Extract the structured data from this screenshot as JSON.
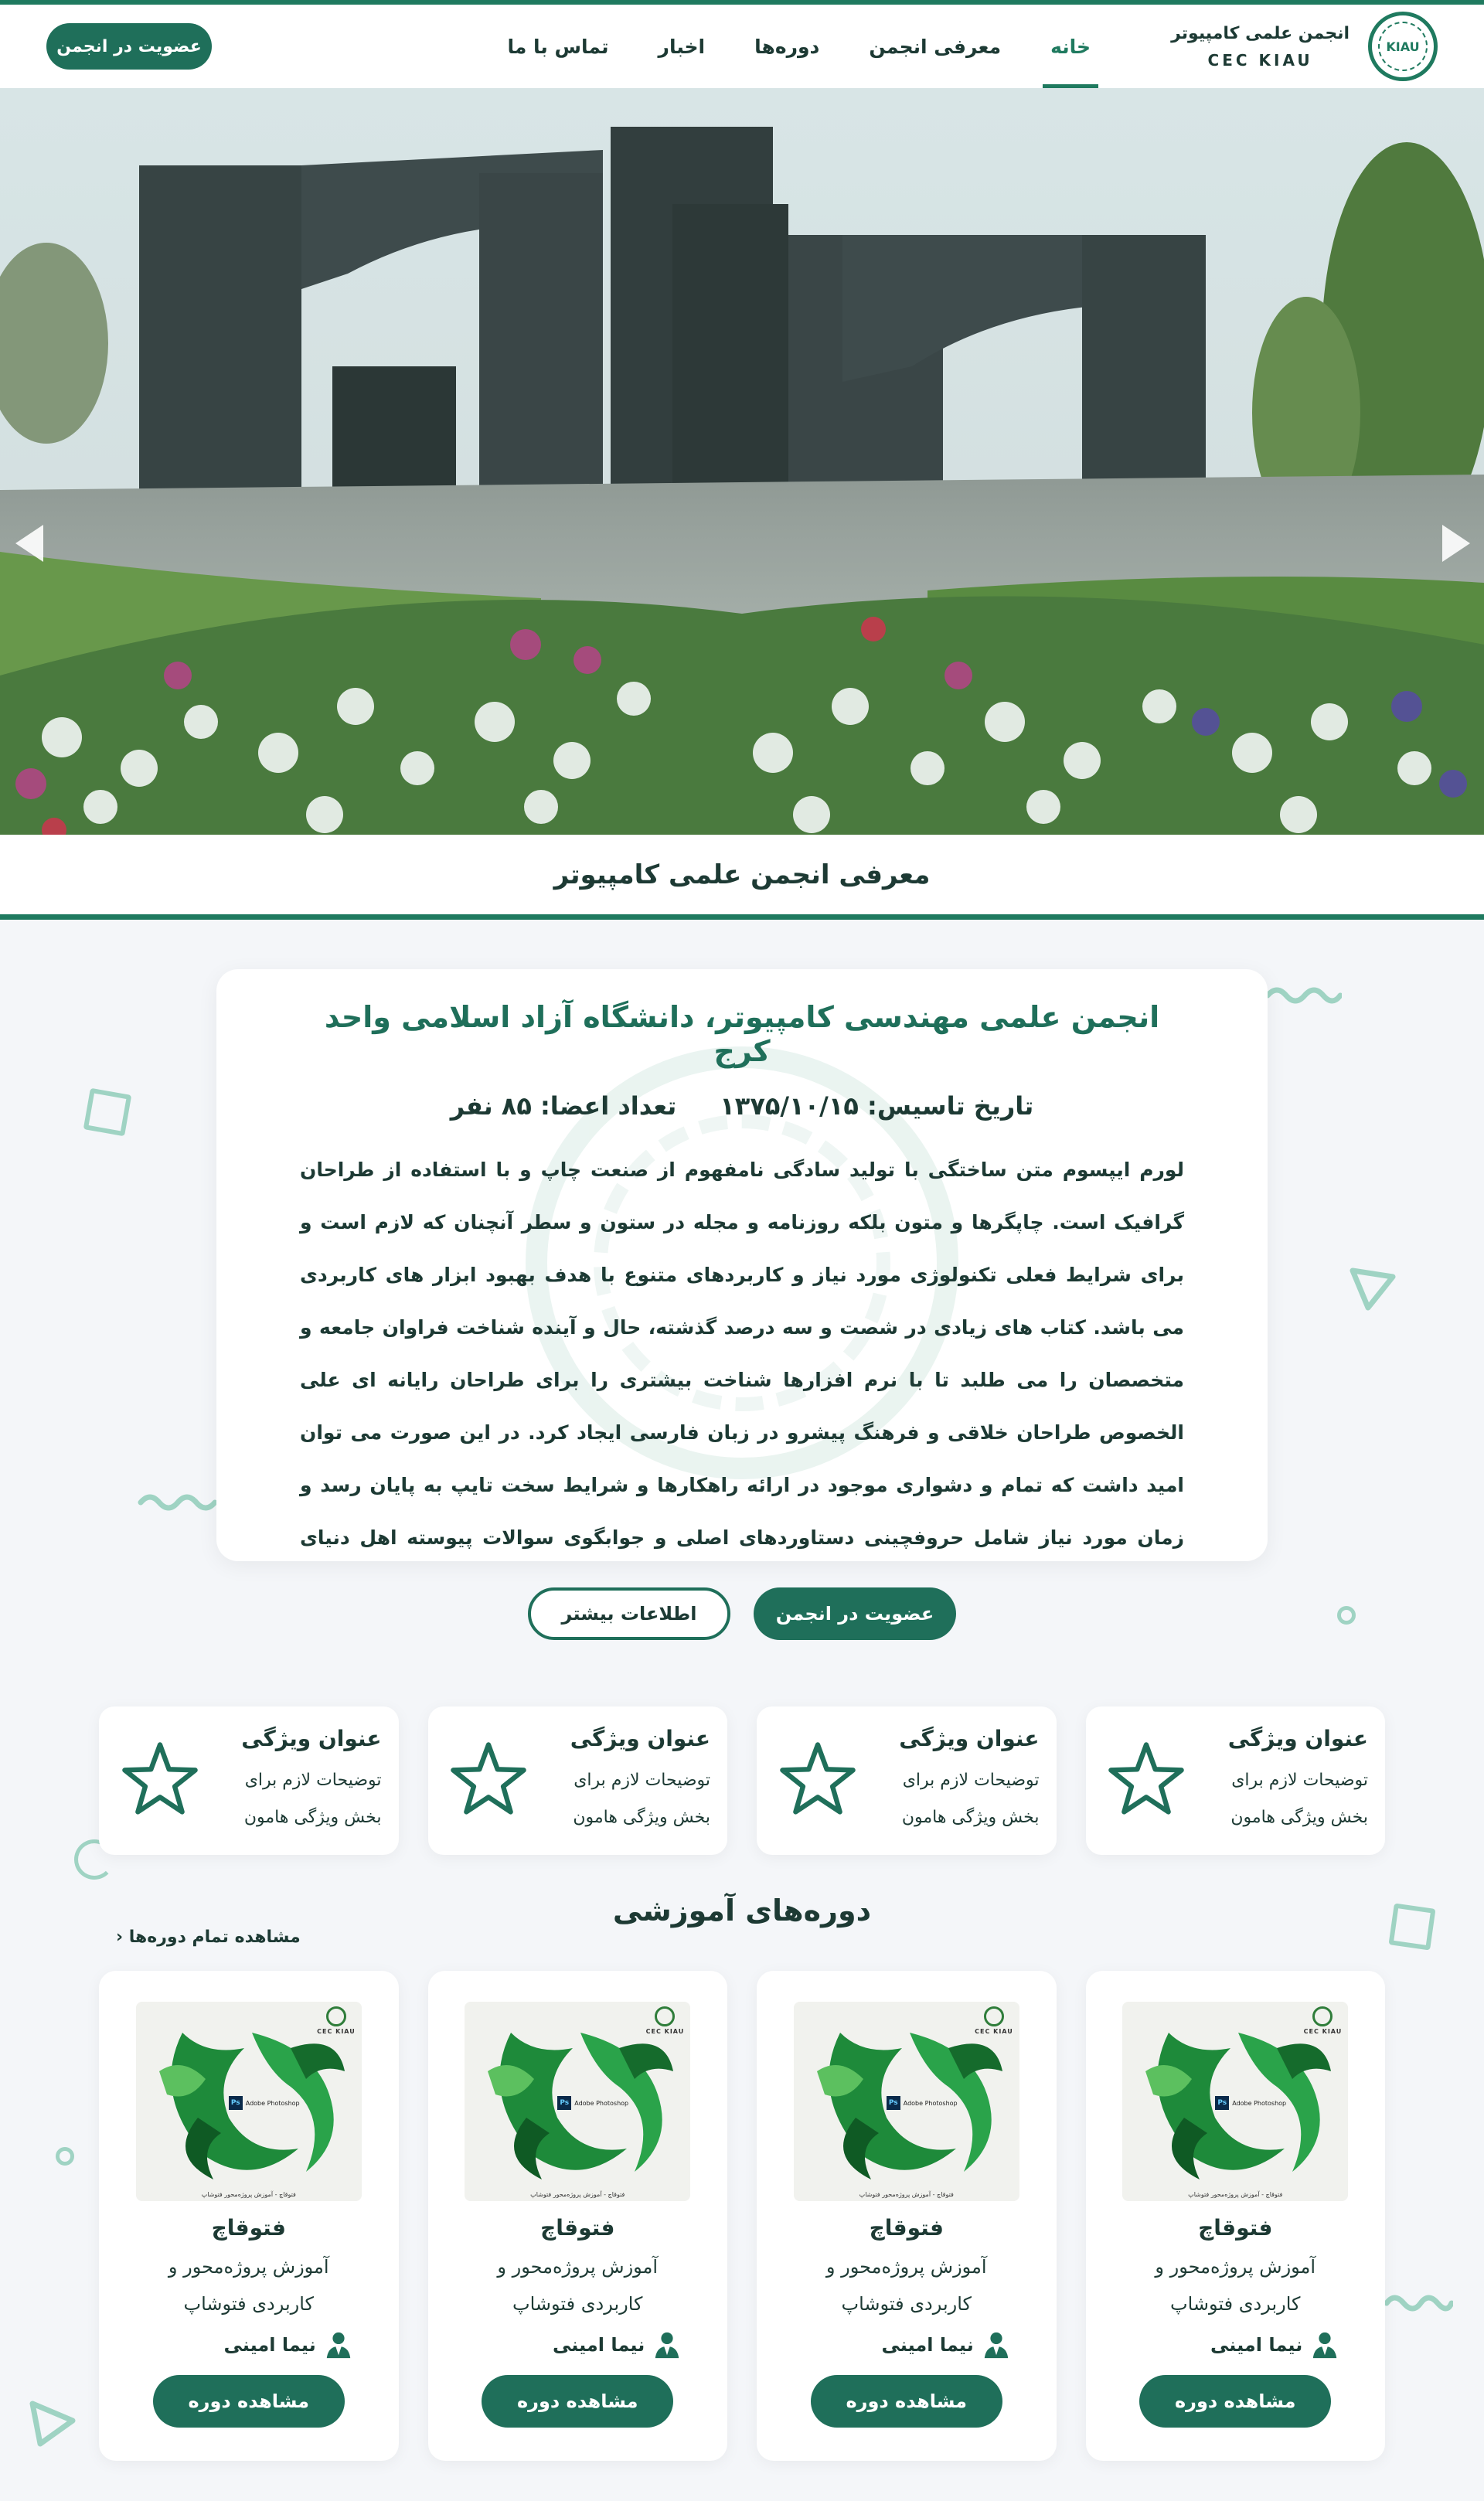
{
  "nav": {
    "logo_title": "انجمن علمی کامپیوتر",
    "logo_sub": "CEC KIAU",
    "logo_mark": "KIAU",
    "items": [
      {
        "label": "خانه",
        "active": true
      },
      {
        "label": "معرفی انجمن",
        "active": false
      },
      {
        "label": "دوره‌ها",
        "active": false
      },
      {
        "label": "اخبار",
        "active": false
      },
      {
        "label": "تماس با ما",
        "active": false
      }
    ],
    "join_label": "عضویت در انجمن"
  },
  "hero": {
    "prev_icon": "chevron-left-icon",
    "next_icon": "chevron-right-icon",
    "scroll_icon": "mouse-scroll-icon"
  },
  "intro_band": {
    "title": "معرفی انجمن علمی کامپیوتر"
  },
  "about": {
    "title": "انجمن علمی مهندسی کامپیوتر، دانشگاه آزاد اسلامی واحد کرج",
    "founded": "تاریخ تاسیس: ۱۳۷۵/۱۰/۱۵",
    "members": "تعداد اعضا: ۸۵ نفر",
    "text": "لورم ایپسوم متن ساختگی با تولید سادگی نامفهوم از صنعت چاپ و با استفاده از طراحان گرافیک است. چاپگرها و متون بلکه روزنامه و مجله در ستون و سطر آنچنان که لازم است و برای شرایط فعلی تکنولوژی مورد نیاز و کاربردهای متنوع با هدف بهبود ابزار های کاربردی می باشد. کتاب های زیادی در شصت و سه درصد گذشته، حال و آینده شناخت فراوان جامعه و متخصصان را می طلبد تا با نرم افزارها شناخت بیشتری را برای طراحان رایانه ای علی الخصوص طراحان خلاقی و فرهنگ پیشرو در زبان فارسی ایجاد کرد. در این صورت می توان امید داشت که تمام و دشواری موجود در ارائه راهکارها و شرایط سخت تایپ به پایان رسد و زمان مورد نیاز شامل حروفچینی دستاوردهای اصلی و جوابگوی سوالات پیوسته اهل دنیای موجود طراحی اساسا مورد استفاده قرار گیرد.",
    "more_label": "اطلاعات بیشتر",
    "join_label": "عضویت در انجمن"
  },
  "features": [
    {
      "title": "عنوان ویژگی",
      "desc": "توضیحات لازم برای بخش ویژگی هامون",
      "icon": "star-icon"
    },
    {
      "title": "عنوان ویژگی",
      "desc": "توضیحات لازم برای بخش ویژگی هامون",
      "icon": "star-icon"
    },
    {
      "title": "عنوان ویژگی",
      "desc": "توضیحات لازم برای بخش ویژگی هامون",
      "icon": "star-icon"
    },
    {
      "title": "عنوان ویژگی",
      "desc": "توضیحات لازم برای بخش ویژگی هامون",
      "icon": "star-icon"
    }
  ],
  "courses": {
    "title": "دوره‌های آموزشی",
    "view_all": "مشاهده تمام دوره‌ها",
    "items": [
      {
        "name": "فتوقاچ",
        "desc": "آموزش پروژه‌محور و کاربردی فتوشاپ",
        "teacher": "نیما امینی",
        "button": "مشاهده دوره",
        "thumb_brand": "CEC KIAU",
        "thumb_product": "Adobe Photoshop",
        "thumb_ps": "Ps",
        "thumb_caption": "فتوقاچ - آموزش پروژه‌محور فتوشاپ"
      },
      {
        "name": "فتوقاچ",
        "desc": "آموزش پروژه‌محور و کاربردی فتوشاپ",
        "teacher": "نیما امینی",
        "button": "مشاهده دوره",
        "thumb_brand": "CEC KIAU",
        "thumb_product": "Adobe Photoshop",
        "thumb_ps": "Ps",
        "thumb_caption": "فتوقاچ - آموزش پروژه‌محور فتوشاپ"
      },
      {
        "name": "فتوقاچ",
        "desc": "آموزش پروژه‌محور و کاربردی فتوشاپ",
        "teacher": "نیما امینی",
        "button": "مشاهده دوره",
        "thumb_brand": "CEC KIAU",
        "thumb_product": "Adobe Photoshop",
        "thumb_ps": "Ps",
        "thumb_caption": "فتوقاچ - آموزش پروژه‌محور فتوشاپ"
      },
      {
        "name": "فتوقاچ",
        "desc": "آموزش پروژه‌محور و کاربردی فتوشاپ",
        "teacher": "نیما امینی",
        "button": "مشاهده دوره",
        "thumb_brand": "CEC KIAU",
        "thumb_product": "Adobe Photoshop",
        "thumb_ps": "Ps",
        "thumb_caption": "فتوقاچ - آموزش پروژه‌محور فتوشاپ"
      }
    ]
  },
  "colors": {
    "primary": "#1f6f5a",
    "accent": "#1f7a5f",
    "text": "#1d3a34",
    "page_bg": "#f4f6f9",
    "deco": "#9fd3c3"
  }
}
